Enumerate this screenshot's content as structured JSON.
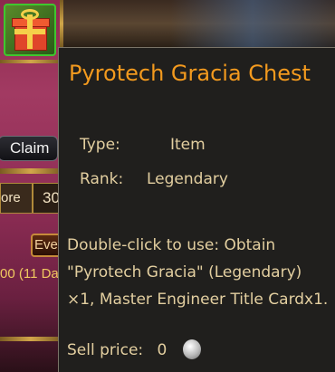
{
  "left_panel": {
    "claim_label": "Claim",
    "ore_fragment": "ore",
    "number_fragment": "30",
    "event_fragment": "Eve",
    "days_fragment": "00 (11 Da"
  },
  "tooltip": {
    "title": "Pyrotech Gracia Chest",
    "type_label": "Type:",
    "type_value": "Item",
    "rank_label": "Rank:",
    "rank_value": "Legendary",
    "description": "Double-click to use: Obtain \"Pyrotech Gracia\" (Legendary) ×1, Master Engineer Title Cardx1.",
    "sell_label": "Sell price:",
    "sell_value": "0",
    "title_color": "#f39a1e",
    "text_color": "#e3cfa0"
  },
  "icons": {
    "gift": "gift-box-icon",
    "coin": "silver-coin-icon"
  }
}
